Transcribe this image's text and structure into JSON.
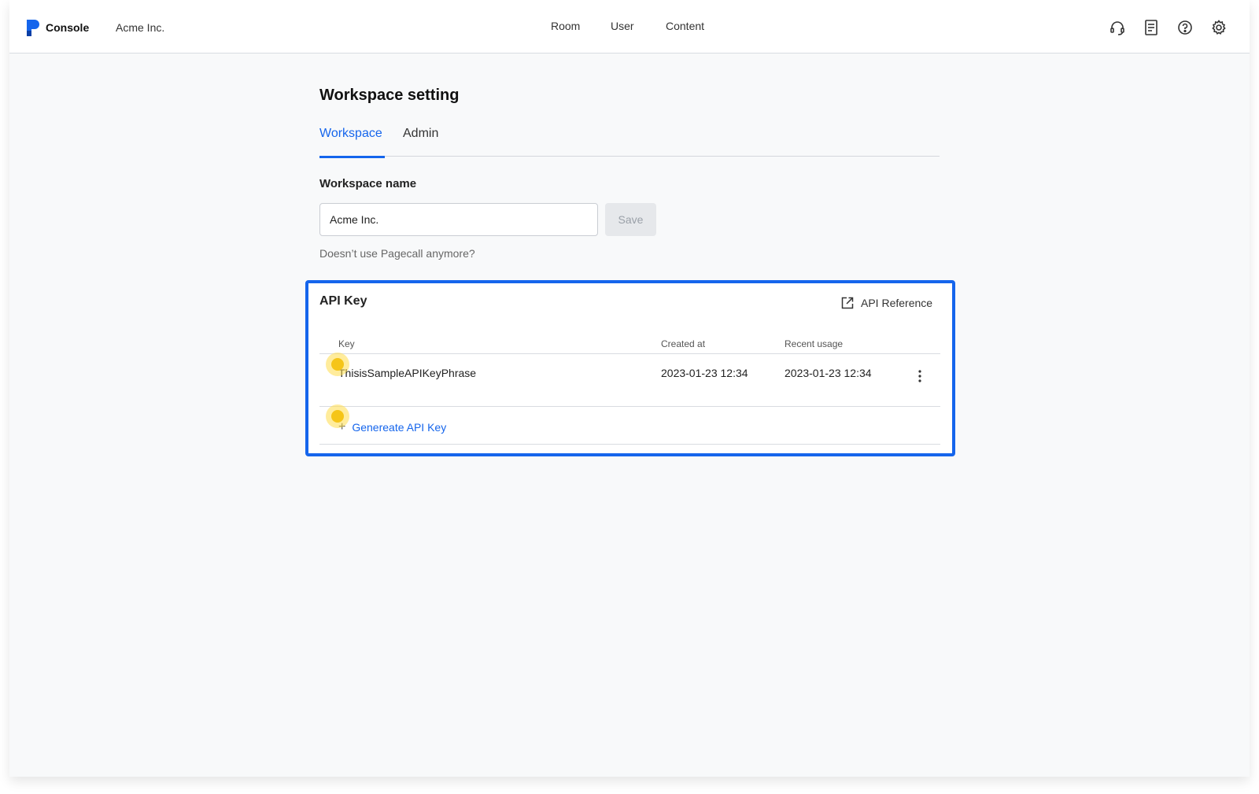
{
  "header": {
    "brand": "Console",
    "org_name": "Acme Inc.",
    "nav": [
      "Room",
      "User",
      "Content"
    ],
    "icons": [
      "headset-icon",
      "document-icon",
      "help-icon",
      "gear-icon"
    ]
  },
  "page": {
    "title": "Workspace setting",
    "tabs": [
      {
        "label": "Workspace",
        "active": true
      },
      {
        "label": "Admin",
        "active": false
      }
    ]
  },
  "workspace_form": {
    "label": "Workspace name",
    "value": "Acme Inc.",
    "save_label": "Save",
    "quit_link": "Doesn’t use Pagecall anymore?"
  },
  "api_key": {
    "title": "API Key",
    "reference_label": "API Reference",
    "columns": [
      "Key",
      "Created at",
      "Recent usage"
    ],
    "rows": [
      {
        "key": "ThisisSampleAPIKeyPhrase",
        "created_at": "2023-01-23 12:34",
        "recent_usage": "2023-01-23 12:34"
      }
    ],
    "generate_label": "Genereate API Key"
  },
  "colors": {
    "accent": "#1565ec",
    "background": "#f8f9fa",
    "marker": "#f5c518"
  }
}
